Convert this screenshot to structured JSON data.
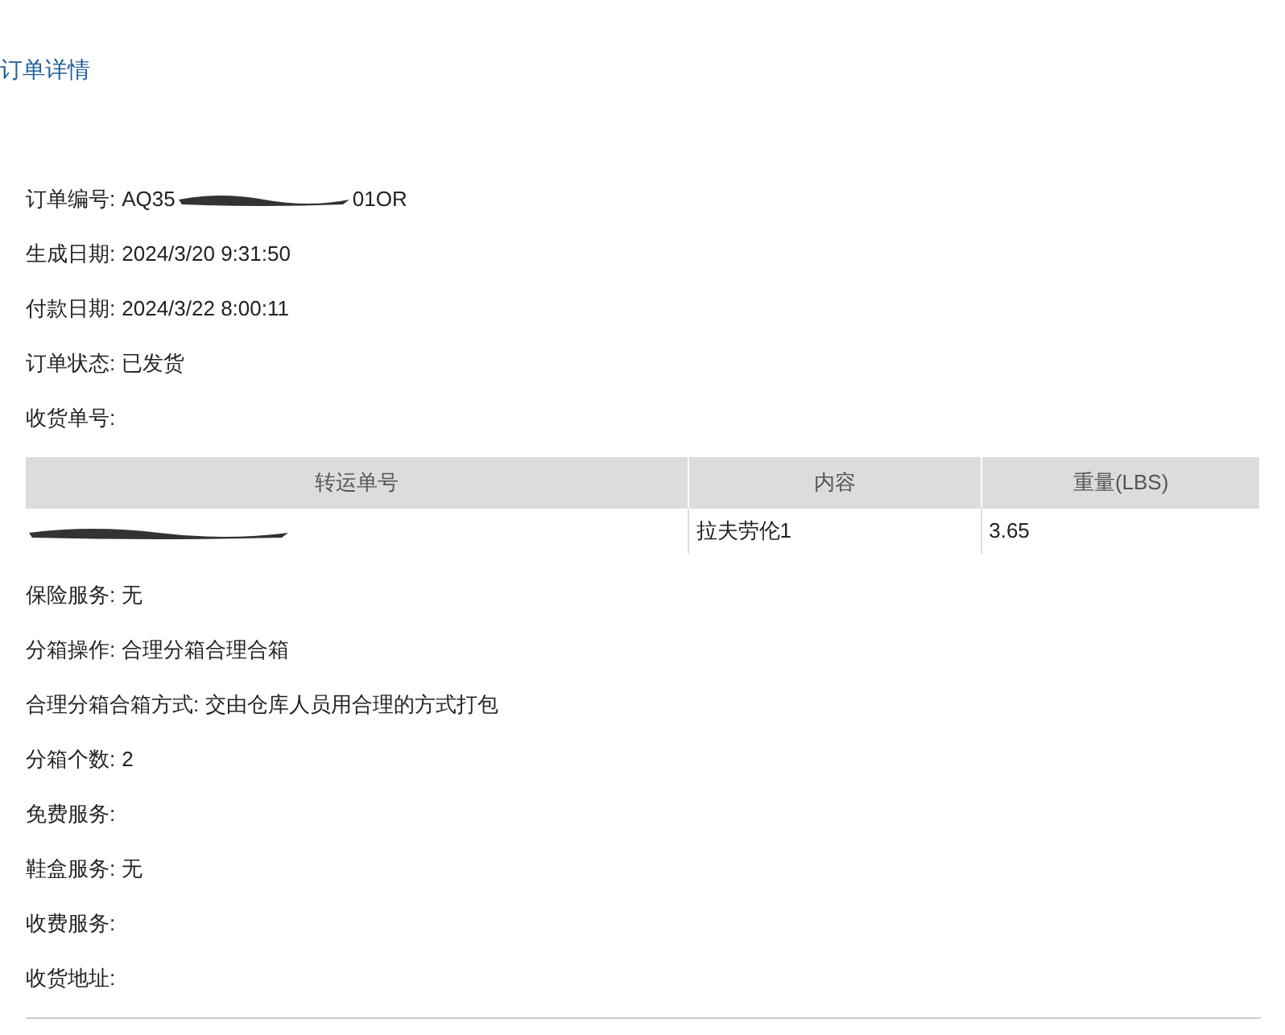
{
  "title": "订单详情",
  "fields_top": [
    {
      "label": "订单编号:",
      "value_start": "AQ35",
      "redacted": true,
      "value_end": "01OR"
    },
    {
      "label": "生成日期:",
      "value_start": "2024/3/20 9:31:50",
      "redacted": false
    },
    {
      "label": "付款日期:",
      "value_start": "2024/3/22 8:00:11",
      "redacted": false
    },
    {
      "label": "订单状态:",
      "value_start": "已发货",
      "redacted": false
    },
    {
      "label": "收货单号:",
      "redacted": false
    }
  ],
  "table": {
    "columns": [
      "转运单号",
      "内容",
      "重量(LBS)"
    ],
    "rows": [
      {
        "tracking_redacted": true,
        "content": "拉夫劳伦1",
        "weight": "3.65"
      }
    ]
  },
  "fields_bottom": [
    {
      "label": "保险服务:",
      "value_start": "无",
      "redacted": false
    },
    {
      "label": "分箱操作:",
      "value_start": "合理分箱合理合箱",
      "redacted": false
    },
    {
      "label": "合理分箱合箱方式:",
      "value_start": "交由仓库人员用合理的方式打包",
      "redacted": false
    },
    {
      "label": "分箱个数:",
      "value_start": "2",
      "redacted": false
    },
    {
      "label": "免费服务:",
      "redacted": false
    },
    {
      "label": "鞋盒服务:",
      "value_start": "无",
      "redacted": false
    },
    {
      "label": "收费服务:",
      "redacted": false
    },
    {
      "label": "收货地址:",
      "redacted": false
    }
  ]
}
